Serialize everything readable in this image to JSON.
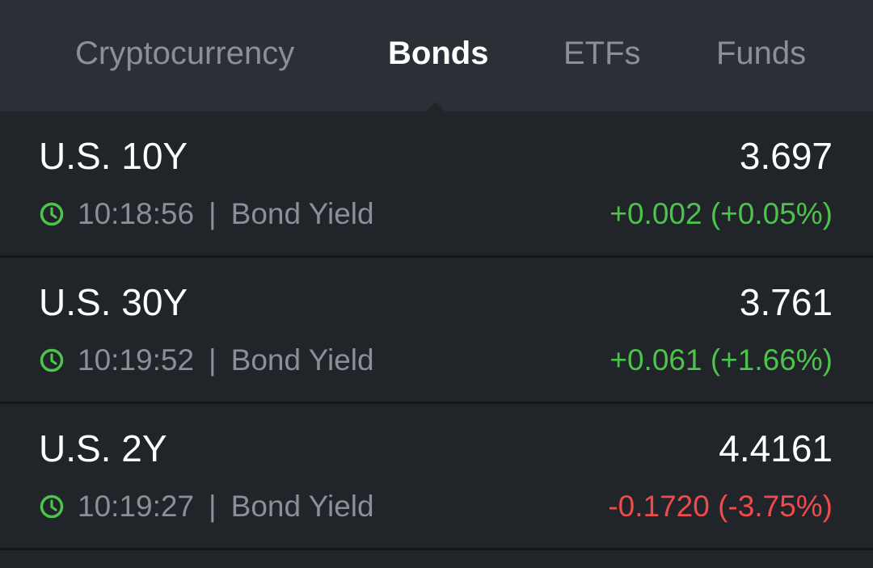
{
  "tabs": [
    {
      "label": "Cryptocurrency",
      "active": false
    },
    {
      "label": "Bonds",
      "active": true
    },
    {
      "label": "ETFs",
      "active": false
    },
    {
      "label": "Funds",
      "active": false
    }
  ],
  "rows": [
    {
      "name": "U.S. 10Y",
      "value": "3.697",
      "time": "10:18:56",
      "type": "Bond Yield",
      "change": "+0.002 (+0.05%)",
      "direction": "up"
    },
    {
      "name": "U.S. 30Y",
      "value": "3.761",
      "time": "10:19:52",
      "type": "Bond Yield",
      "change": "+0.061 (+1.66%)",
      "direction": "up"
    },
    {
      "name": "U.S. 2Y",
      "value": "4.4161",
      "time": "10:19:27",
      "type": "Bond Yield",
      "change": "-0.1720 (-3.75%)",
      "direction": "down"
    }
  ],
  "separator": "|",
  "icons": {
    "clock": "clock-icon"
  },
  "colors": {
    "background": "#212429",
    "tabbar": "#2b2f36",
    "positive": "#4cc44c",
    "negative": "#ef4b4b",
    "muted": "#8a8f98",
    "primary_text": "#ffffff"
  }
}
